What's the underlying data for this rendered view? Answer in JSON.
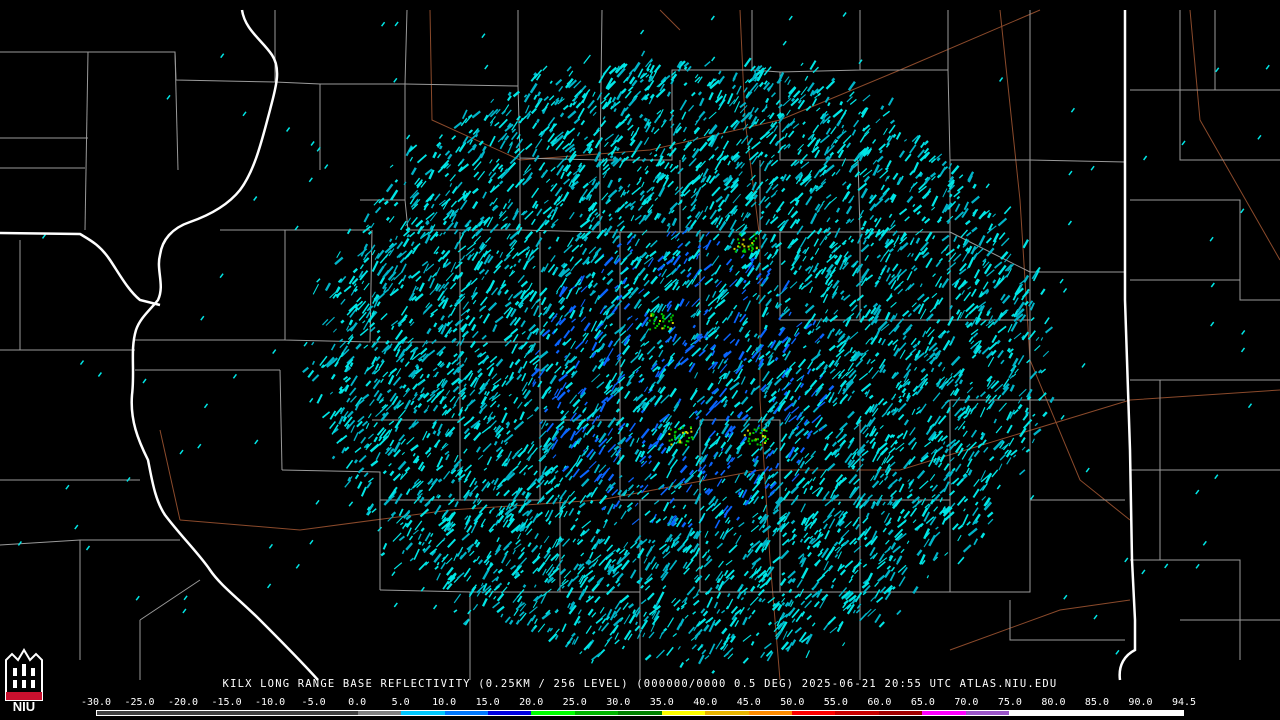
{
  "product_caption": "KILX LONG RANGE BASE REFLECTIVITY (0.25KM / 256 LEVEL) (000000/0000 0.5 DEG) 2025-06-21 20:55 UTC  ATLAS.NIU.EDU",
  "logo": {
    "text": "NIU",
    "icon": "niu-tower-logo-icon",
    "color": "#c8102e"
  },
  "scale": {
    "labels": [
      "-30.0",
      "-25.0",
      "-20.0",
      "-15.0",
      "-10.0",
      "-5.0",
      "0.0",
      "5.0",
      "10.0",
      "15.0",
      "20.0",
      "25.0",
      "30.0",
      "35.0",
      "40.0",
      "45.0",
      "50.0",
      "55.0",
      "60.0",
      "65.0",
      "70.0",
      "75.0",
      "80.0",
      "85.0",
      "90.0",
      "94.5"
    ],
    "colors": [
      "#404040",
      "#404040",
      "#404040",
      "#404040",
      "#404040",
      "#404040",
      "#808080",
      "#00c8ff",
      "#0078ff",
      "#0000e0",
      "#00ff00",
      "#00b400",
      "#008000",
      "#ffff00",
      "#e6b400",
      "#ff8c00",
      "#ff0000",
      "#c80000",
      "#a00000",
      "#ff00ff",
      "#9a55c8",
      "#ffffff",
      "#ffffff",
      "#ffffff",
      "#ffffff"
    ]
  },
  "colors": {
    "state_border": "#ffffff",
    "county_border": "#9a9a9a",
    "roads": "#8b4a2b",
    "echo_primary": "#00e6e6",
    "echo_light": "#00b4c8",
    "echo_blue": "#0a64ff",
    "echo_green": "#00c800",
    "echo_yellow": "#d2d200"
  },
  "radar": {
    "site": "KILX",
    "tilt_deg": 0.5
  }
}
